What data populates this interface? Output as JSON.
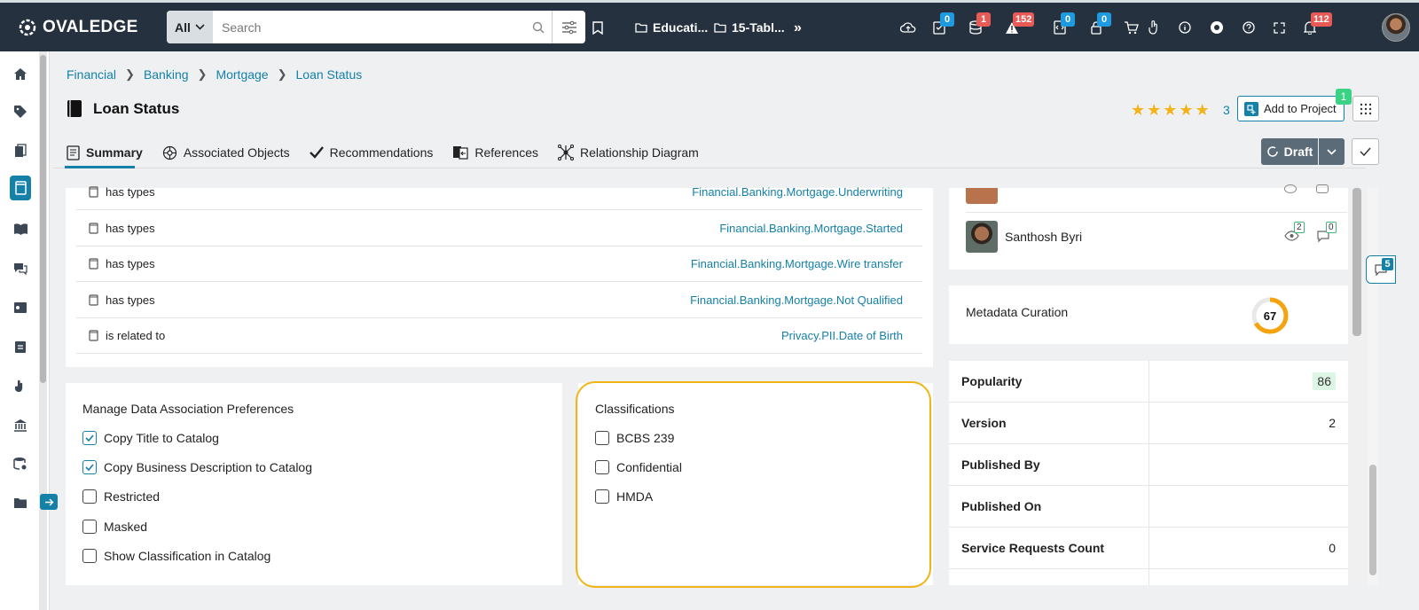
{
  "topbar": {
    "logo_text": "OVALEDGE",
    "search_scope": "All",
    "search_placeholder": "Search",
    "recent_folder_1": "Educati...",
    "recent_folder_2": "15-Tabl...",
    "badges": {
      "data_quality": "0",
      "database": "1",
      "alerts": "152",
      "code": "0",
      "access": "0",
      "notifications": "112"
    }
  },
  "breadcrumb": {
    "items": [
      "Financial",
      "Banking",
      "Mortgage",
      "Loan Status"
    ]
  },
  "page": {
    "title": "Loan Status",
    "rating_value": 5,
    "rating_count": "3",
    "add_to_project_label": "Add to Project",
    "project_count": "1",
    "status_label": "Draft"
  },
  "tabs": [
    {
      "label": "Summary"
    },
    {
      "label": "Associated Objects"
    },
    {
      "label": "Recommendations"
    },
    {
      "label": "References"
    },
    {
      "label": "Relationship Diagram"
    }
  ],
  "relationships": [
    {
      "type": "has types",
      "target": "Financial.Banking.Mortgage.Underwriting"
    },
    {
      "type": "has types",
      "target": "Financial.Banking.Mortgage.Started"
    },
    {
      "type": "has types",
      "target": "Financial.Banking.Mortgage.Wire transfer"
    },
    {
      "type": "has types",
      "target": "Financial.Banking.Mortgage.Not Qualified"
    },
    {
      "type": "is related to",
      "target": "Privacy.PII.Date of Birth"
    }
  ],
  "association_prefs": {
    "title": "Manage Data Association Preferences",
    "items": [
      {
        "label": "Copy Title to Catalog",
        "checked": true
      },
      {
        "label": "Copy Business Description to Catalog",
        "checked": true
      },
      {
        "label": "Restricted",
        "checked": false
      },
      {
        "label": "Masked",
        "checked": false
      },
      {
        "label": "Show Classification in Catalog",
        "checked": false
      }
    ]
  },
  "classifications": {
    "title": "Classifications",
    "items": [
      {
        "label": "BCBS 239",
        "checked": false
      },
      {
        "label": "Confidential",
        "checked": false
      },
      {
        "label": "HMDA",
        "checked": false
      }
    ]
  },
  "watchers": {
    "user_name": "Santhosh Byri",
    "views": "2",
    "comments": "0"
  },
  "metadata_curation": {
    "label": "Metadata Curation",
    "score": "67",
    "score_fraction": 0.67
  },
  "stats": [
    {
      "key": "Popularity",
      "value": "86"
    },
    {
      "key": "Version",
      "value": "2"
    },
    {
      "key": "Published By",
      "value": ""
    },
    {
      "key": "Published On",
      "value": ""
    },
    {
      "key": "Service Requests Count",
      "value": "0"
    }
  ],
  "floating_comments": "5",
  "colors": {
    "accent": "#1580a8",
    "topbar": "#25313f",
    "highlight": "#f0b515",
    "star": "#f2b31b",
    "badge_green": "#3cd286"
  }
}
